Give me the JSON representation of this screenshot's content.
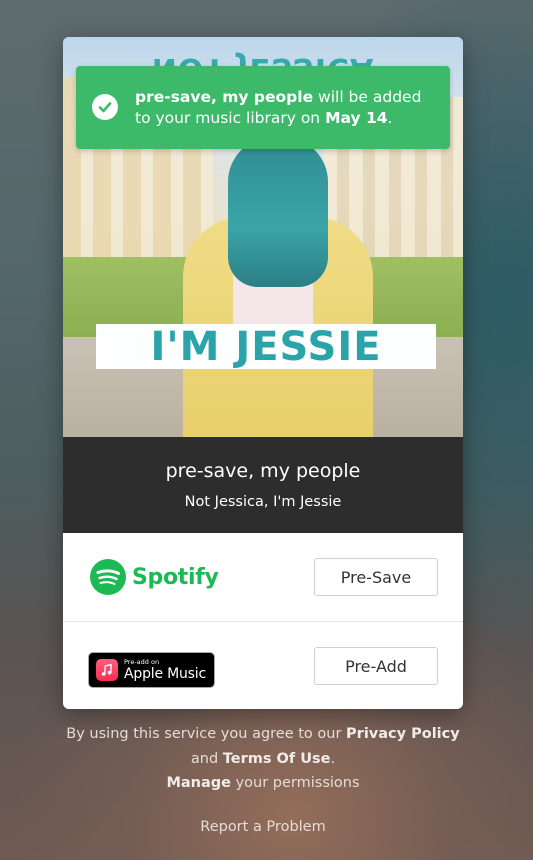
{
  "toast": {
    "title_bold": "pre-save, my people",
    "text_mid": " will be added to your music library on ",
    "date_bold": "May 14",
    "text_end": ".",
    "icon": "check-circle-icon",
    "color": "#3cba6a"
  },
  "artwork": {
    "overlay_title": "I'M JESSIE",
    "top_text": "NOT JESSICA"
  },
  "release": {
    "title": "pre-save, my people",
    "subtitle": "Not Jessica, I'm Jessie"
  },
  "services": [
    {
      "name": "Spotify",
      "logo_icon": "spotify-icon",
      "button_label": "Pre-Save",
      "brand_color": "#1db954"
    },
    {
      "name": "Apple Music",
      "badge_small": "Pre-add on",
      "logo_icon": "apple-music-icon",
      "button_label": "Pre-Add"
    }
  ],
  "footer": {
    "line1_prefix": "By using this service you agree to our ",
    "privacy_label": "Privacy Policy",
    "and_text": " and ",
    "terms_label": "Terms Of Use",
    "period": ".",
    "manage_label": "Manage",
    "manage_suffix": " your permissions",
    "report_label": "Report a Problem"
  }
}
